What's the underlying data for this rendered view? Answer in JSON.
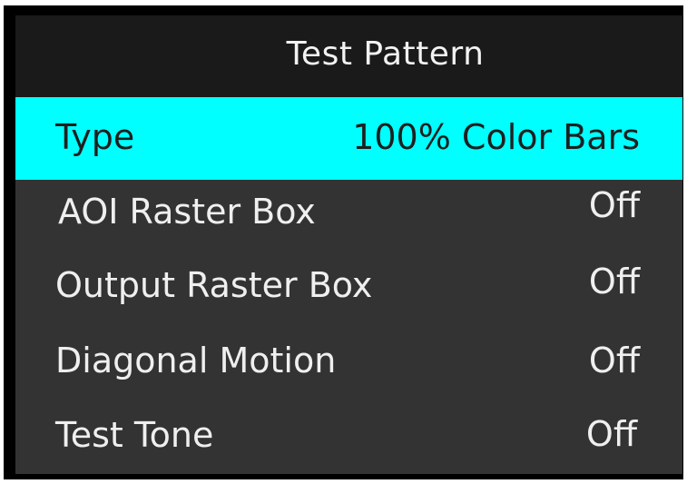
{
  "menu": {
    "title": "Test Pattern",
    "colors": {
      "highlight": "#00ffff",
      "background": "#333333",
      "header": "#1a1a1a",
      "text": "#efefef"
    },
    "items": [
      {
        "label": "Type",
        "value": "100% Color Bars",
        "selected": true
      },
      {
        "label": "AOI Raster Box",
        "value": "Off",
        "selected": false
      },
      {
        "label": "Output Raster Box",
        "value": "Off",
        "selected": false
      },
      {
        "label": "Diagonal Motion",
        "value": "Off",
        "selected": false
      },
      {
        "label": "Test Tone",
        "value": "Off",
        "selected": false
      }
    ]
  }
}
